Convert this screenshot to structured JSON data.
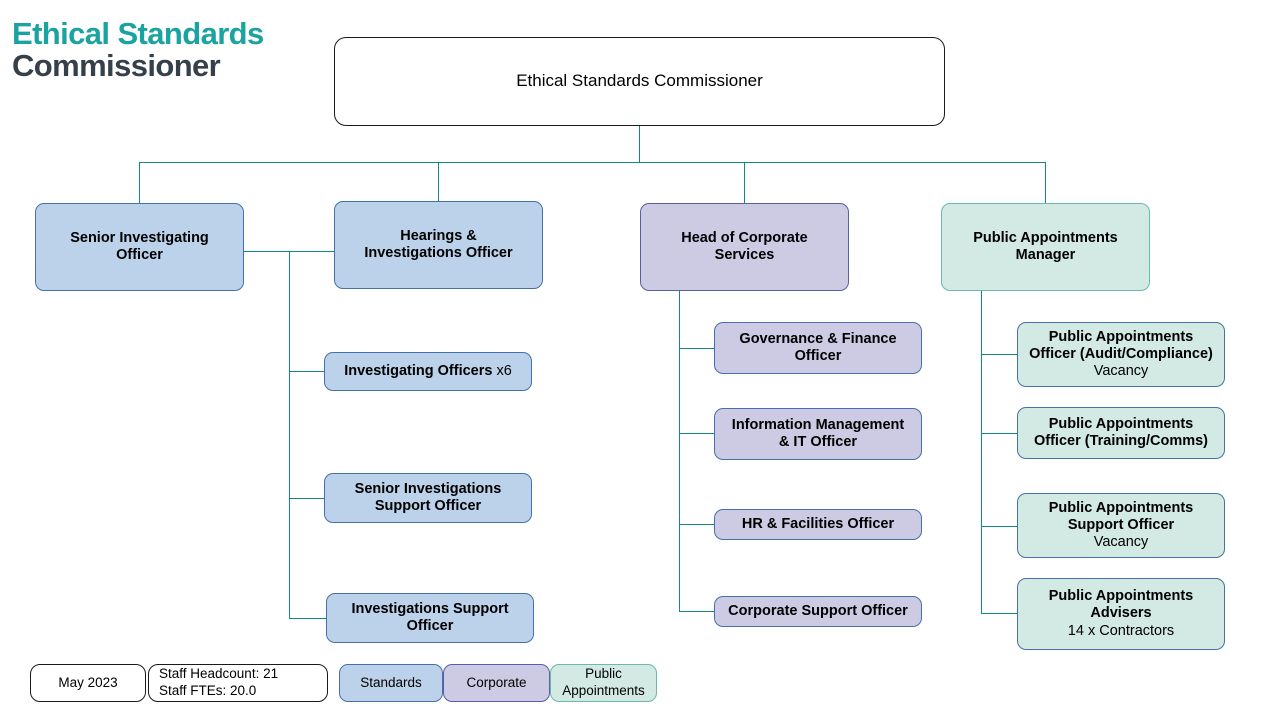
{
  "logo": {
    "line1": "Ethical Standards",
    "line2": "Commissioner",
    "color_primary": "#1aa3a0",
    "color_secondary": "#36404a"
  },
  "colors": {
    "standards_fill": "#bcd2ea",
    "standards_border": "#4472a8",
    "corporate_fill": "#cdcbe3",
    "corporate_border": "#5b5ea6",
    "appointments_fill": "#d3e9e3",
    "appointments_border": "#6cb8ad",
    "connector": "#138a7e",
    "root_border": "#1a1a1a"
  },
  "chart_data": {
    "type": "diagram",
    "diagram_type": "organisation-chart",
    "title": "Ethical Standards Commissioner organisation chart",
    "root": "Ethical Standards Commissioner",
    "levels": 3,
    "branches": [
      {
        "name": "Senior Investigating Officer",
        "group": "Standards",
        "children": []
      },
      {
        "name": "Hearings & Investigations Officer",
        "group": "Standards",
        "children": [
          "Investigating Officers x6",
          "Senior Investigations Support Officer",
          "Investigations Support Officer"
        ]
      },
      {
        "name": "Head of Corporate Services",
        "group": "Corporate",
        "children": [
          "Governance & Finance Officer",
          "Information Management & IT Officer",
          "HR & Facilities Officer",
          "Corporate Support Officer"
        ]
      },
      {
        "name": "Public Appointments Manager",
        "group": "Public Appointments",
        "children": [
          "Public Appointments Officer (Audit/Compliance) - Vacancy",
          "Public Appointments Officer (Training/Comms)",
          "Public Appointments Support Officer - Vacancy",
          "Public Appointments Advisers - 14 x Contractors"
        ]
      }
    ]
  },
  "root": {
    "title": "Ethical Standards Commissioner"
  },
  "level2": [
    {
      "title_line1": "Senior Investigating",
      "title_line2": "Officer",
      "group": "standards"
    },
    {
      "title_line1": "Hearings &",
      "title_line2": "Investigations Officer",
      "group": "standards"
    },
    {
      "title_line1": "Head of Corporate",
      "title_line2": "Services",
      "group": "corporate"
    },
    {
      "title_line1": "Public Appointments",
      "title_line2": "Manager",
      "group": "appointments"
    }
  ],
  "standards_children": [
    {
      "title": "Investigating Officers",
      "inline_sub": " x6",
      "title_line2": ""
    },
    {
      "title": "Senior Investigations",
      "title_line2": "Support Officer",
      "inline_sub": ""
    },
    {
      "title": "Investigations Support",
      "title_line2": "Officer",
      "inline_sub": ""
    }
  ],
  "corporate_children": [
    {
      "title": "Governance & Finance",
      "title_line2": "Officer",
      "sub": ""
    },
    {
      "title": "Information Management",
      "title_line2": "& IT Officer",
      "sub": ""
    },
    {
      "title": "HR & Facilities Officer",
      "title_line2": "",
      "sub": ""
    },
    {
      "title": "Corporate Support Officer",
      "title_line2": "",
      "sub": ""
    }
  ],
  "appointments_children": [
    {
      "title": "Public Appointments",
      "title_line2": "Officer (Audit/Compliance)",
      "sub": "Vacancy"
    },
    {
      "title": "Public Appointments",
      "title_line2": "Officer (Training/Comms)",
      "sub": ""
    },
    {
      "title": "Public Appointments",
      "title_line2": "Support Officer",
      "sub": "Vacancy"
    },
    {
      "title": "Public Appointments",
      "title_line2": "Advisers",
      "sub": "14 x Contractors"
    }
  ],
  "legend": {
    "date": "May 2023",
    "headcount_line1": "Staff Headcount: 21",
    "headcount_line2": "Staff FTEs: 20.0",
    "key_standards": "Standards",
    "key_corporate": "Corporate",
    "key_appointments_line1": "Public",
    "key_appointments_line2": "Appointments"
  }
}
